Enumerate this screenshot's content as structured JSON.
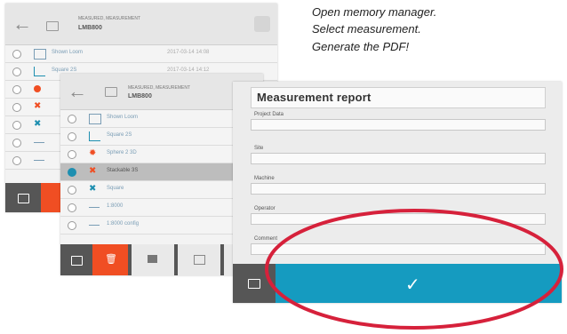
{
  "instructions": [
    "Open memory manager.",
    "Select measurement.",
    "Generate the PDF!"
  ],
  "back_screen": {
    "header": {
      "small": "MEASURED, MEASUREMENT",
      "folder_name": "LMB800"
    },
    "rows": [
      {
        "name": "Shown Loom",
        "date": "2017-03-14   14:08"
      },
      {
        "name": "Square 2S",
        "date": "2017-03-14   14:12"
      }
    ]
  },
  "mid_screen": {
    "header": {
      "small": "MEASURED, MEASUREMENT",
      "folder_name": "LMB800"
    },
    "rows": [
      {
        "name": "Shown Loom"
      },
      {
        "name": "Square 2S"
      },
      {
        "name": "Sphere 2 3D"
      },
      {
        "name": "Stackable 3S"
      },
      {
        "name": "Square"
      },
      {
        "name": "1:8000"
      },
      {
        "name": "1:8000 config"
      }
    ]
  },
  "report": {
    "title": "Measurement report",
    "fields": [
      {
        "label": "Project Data"
      },
      {
        "label": "Site"
      },
      {
        "label": "Machine"
      },
      {
        "label": "Operator"
      },
      {
        "label": "Comment"
      }
    ]
  },
  "colors": {
    "accent_orange": "#f04e23",
    "confirm_blue": "#159bc0",
    "highlight_red": "#d6213b"
  }
}
